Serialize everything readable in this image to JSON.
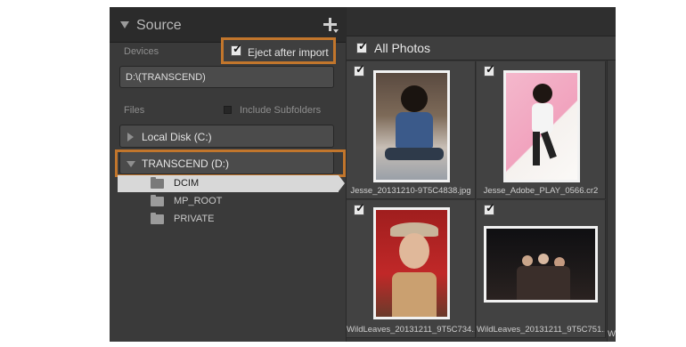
{
  "source_panel": {
    "title": "Source",
    "devices_label": "Devices",
    "eject_after_import": {
      "label": "Eject after import",
      "checked": true
    },
    "device_path": "D:\\(TRANSCEND)",
    "files_label": "Files",
    "include_subfolders": {
      "label": "Include Subfolders",
      "checked": false
    },
    "disks": [
      {
        "label": "Local Disk (C:)",
        "expanded": false
      },
      {
        "label": "TRANSCEND (D:)",
        "expanded": true
      }
    ],
    "folders": [
      {
        "label": "DCIM",
        "selected": true
      },
      {
        "label": "MP_ROOT",
        "selected": false
      },
      {
        "label": "PRIVATE",
        "selected": false
      }
    ]
  },
  "grid": {
    "header_label": "All Photos",
    "header_checked": true,
    "photos": [
      {
        "filename": "Jesse_20131210-9T5C4838.jpg",
        "checked": true
      },
      {
        "filename": "Jesse_Adobe_PLAY_0566.cr2",
        "checked": true
      },
      {
        "filename": "WildLeaves_20131211_9T5C734...",
        "checked": true
      },
      {
        "filename": "WildLeaves_20131211_9T5C751...",
        "checked": true
      }
    ],
    "partial_filename": "W"
  },
  "colors": {
    "highlight_outline": "#c2762c",
    "panel_bg": "#3a3a3a",
    "selected_row": "#d8d8d8"
  },
  "icons": [
    "collapse-triangle-icon",
    "add-source-icon",
    "checkbox-icon",
    "expand-triangle-icon",
    "folder-icon"
  ]
}
